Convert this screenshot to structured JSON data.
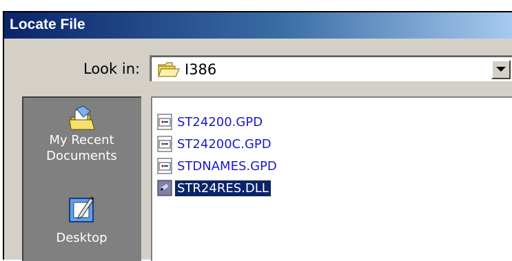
{
  "window": {
    "title": "Locate File"
  },
  "lookin": {
    "label": "Look in:",
    "value": "I386"
  },
  "places": [
    {
      "label_lines": [
        "My Recent",
        "Documents"
      ],
      "icon": "recent-documents-icon"
    },
    {
      "label_lines": [
        "Desktop"
      ],
      "icon": "desktop-icon"
    }
  ],
  "files": [
    {
      "name": "ST24200.GPD",
      "icon": "gpd-file-icon",
      "selected": false
    },
    {
      "name": "ST24200C.GPD",
      "icon": "gpd-file-icon",
      "selected": false
    },
    {
      "name": "STDNAMES.GPD",
      "icon": "gpd-file-icon",
      "selected": false
    },
    {
      "name": "STR24RES.DLL",
      "icon": "dll-file-icon",
      "selected": true
    }
  ],
  "colors": {
    "title_bar": "#0a246a",
    "selection": "#0a246a",
    "file_text": "#1a1ac8",
    "face": "#d4d0c8"
  }
}
